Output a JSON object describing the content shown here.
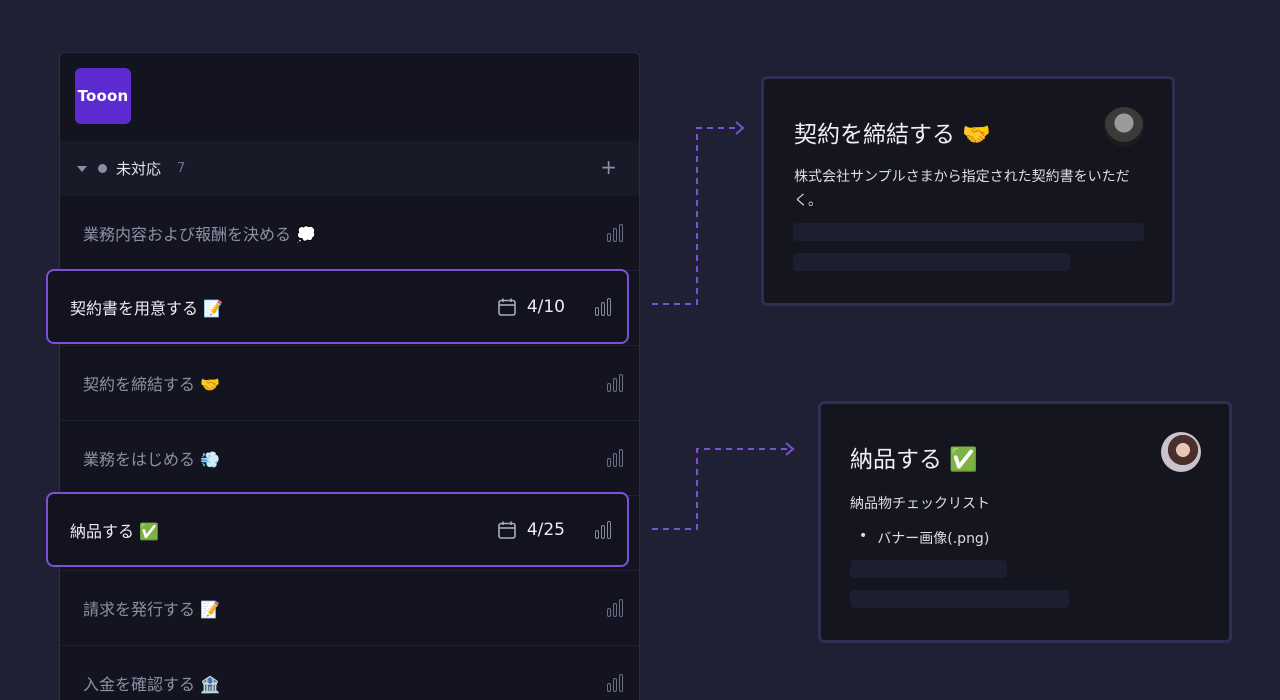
{
  "app": {
    "logo_text": "Tooon",
    "brand_color": "#5b2bd1",
    "accent_color": "#7b52d6"
  },
  "group": {
    "label": "未対応",
    "count": "7",
    "add_label": "+"
  },
  "tasks": [
    {
      "title": "業務内容および報酬を決める 💭"
    },
    {
      "title": "契約書を用意する 📝",
      "due": "4/10",
      "highlighted": true
    },
    {
      "title": "契約を締結する 🤝"
    },
    {
      "title": "業務をはじめる 💨"
    },
    {
      "title": "納品する ✅",
      "due": "4/25",
      "highlighted": true
    },
    {
      "title": "請求を発行する 📝"
    },
    {
      "title": "入金を確認する 🏦"
    }
  ],
  "cards": [
    {
      "title": "契約を締結する 🤝",
      "description": "株式会社サンプルさまから指定された契約書をいただく。"
    },
    {
      "title": "納品する ✅",
      "description": "納品物チェックリスト",
      "bullets": [
        "バナー画像(.png)"
      ]
    }
  ]
}
